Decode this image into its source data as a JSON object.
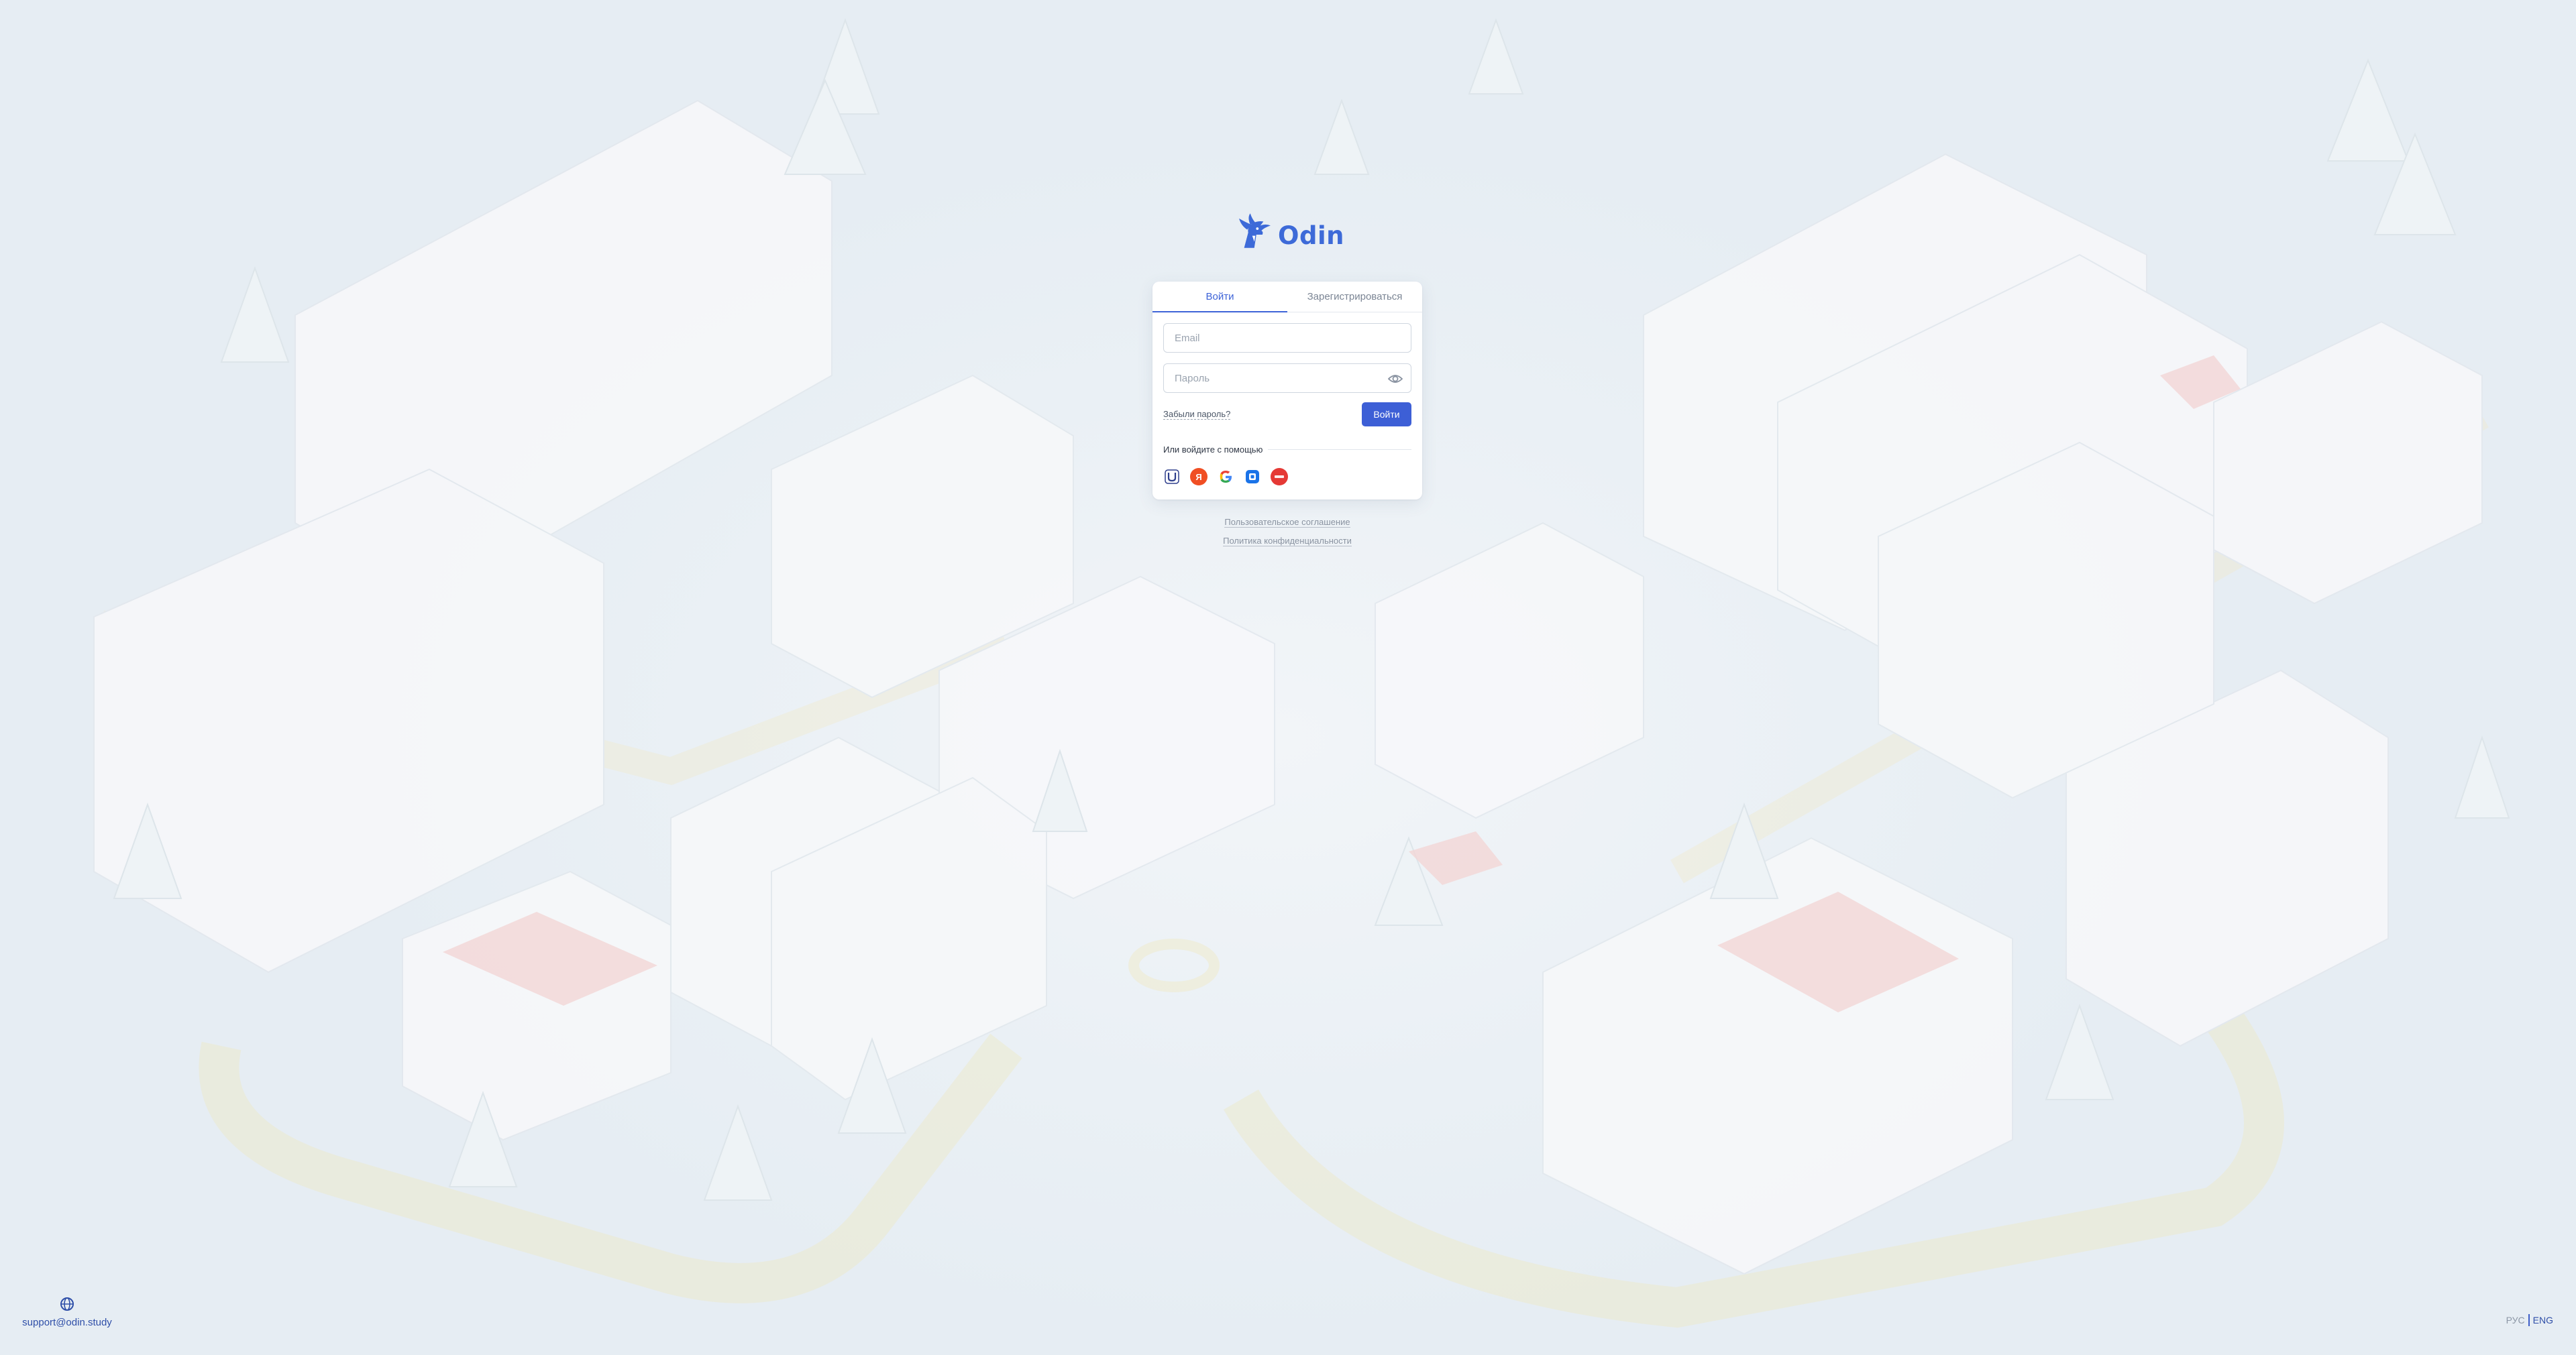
{
  "brand": {
    "name": "Odin",
    "color": "#3d6ad8"
  },
  "auth": {
    "tabs": [
      {
        "label": "Войти",
        "active": true
      },
      {
        "label": "Зарегистрироваться",
        "active": false
      }
    ],
    "email_placeholder": "Email",
    "password_placeholder": "Пароль",
    "forgot_label": "Забыли пароль?",
    "submit_label": "Войти",
    "social_divider": "Или войдите с помощью",
    "social_providers": [
      {
        "name": "unikum",
        "icon": "unikum-icon",
        "glyph": "U",
        "color": "#ffffff"
      },
      {
        "name": "yandex",
        "icon": "yandex-icon",
        "glyph": "Я",
        "color": "#f04e23"
      },
      {
        "name": "google",
        "icon": "google-icon",
        "glyph": "G",
        "color": "#ffffff"
      },
      {
        "name": "vk",
        "icon": "vk-id-icon",
        "glyph": "",
        "color": "#1a73e8"
      },
      {
        "name": "sber",
        "icon": "mos-ru-icon",
        "glyph": "",
        "color": "#e53935"
      }
    ]
  },
  "legal": {
    "terms": "Пользовательское соглашение",
    "privacy": "Политика конфиденциальности"
  },
  "footer": {
    "support_email": "support@odin.study",
    "support_icon": "globe-icon",
    "lang_ru": "РУС",
    "lang_en": "ENG",
    "active_lang": "ENG"
  },
  "colors": {
    "accent": "#3d5fd6",
    "background": "#edf2f6"
  }
}
